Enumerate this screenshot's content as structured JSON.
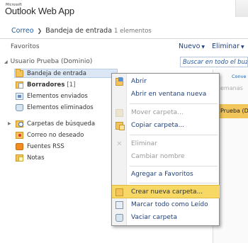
{
  "app": {
    "vendor": "Microsoft",
    "title": "Outlook Web App"
  },
  "breadcrumb": {
    "root": "Correo",
    "current": "Bandeja de entrada",
    "count": "1 elementos"
  },
  "toolbar": {
    "new_label": "Nuevo",
    "delete_label": "Eliminar"
  },
  "search": {
    "placeholder": "Buscar en todo el buzón"
  },
  "sidebar": {
    "favorites_label": "Favoritos",
    "mailbox_label": "Usuario Prueba (Dominio)",
    "folders": [
      {
        "label": "Bandeja de entrada",
        "unread": ""
      },
      {
        "label": "Borradores",
        "unread": "[1]"
      },
      {
        "label": "Elementos enviados",
        "unread": ""
      },
      {
        "label": "Elementos eliminados",
        "unread": ""
      },
      {
        "label": "Carpetas de búsqueda",
        "unread": ""
      },
      {
        "label": "Correo no deseado",
        "unread": ""
      },
      {
        "label": "Fuentes RSS",
        "unread": ""
      },
      {
        "label": "Notas",
        "unread": ""
      }
    ]
  },
  "reading_pane": {
    "column_header": "Conve",
    "row_faded": "emanas",
    "row_selected": "Prueba (D"
  },
  "context_menu": {
    "items": [
      {
        "label": "Abrir",
        "enabled": true
      },
      {
        "label": "Abrir en ventana nueva",
        "enabled": true
      },
      {
        "label": "Mover carpeta...",
        "enabled": false
      },
      {
        "label": "Copiar carpeta...",
        "enabled": true
      },
      {
        "label": "Eliminar",
        "enabled": false
      },
      {
        "label": "Cambiar nombre",
        "enabled": false
      },
      {
        "label": "Agregar a Favoritos",
        "enabled": true
      },
      {
        "label": "Crear nueva carpeta...",
        "enabled": true
      },
      {
        "label": "Marcar todo como Leído",
        "enabled": true
      },
      {
        "label": "Vaciar carpeta",
        "enabled": true
      }
    ]
  },
  "colors": {
    "accent_link": "#1f5fa8",
    "selection": "#dbe7f5",
    "menu_highlight": "#f7d865"
  }
}
